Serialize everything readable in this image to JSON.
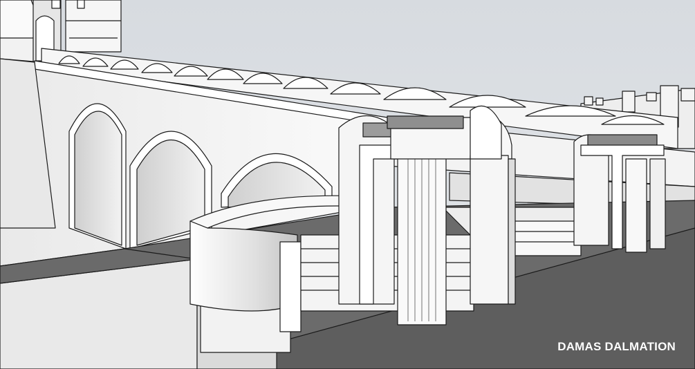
{
  "watermark": {
    "text": "DAMAS DALMATION"
  },
  "colors": {
    "sky": "#d9dde1",
    "ground": "#6b6b6b",
    "ground_dark": "#5a5a5a",
    "surface": "#f4f4f4",
    "surface_shade": "#d6d6d6",
    "line": "#1a1a1a"
  },
  "icons": [
    "sketch-render"
  ]
}
